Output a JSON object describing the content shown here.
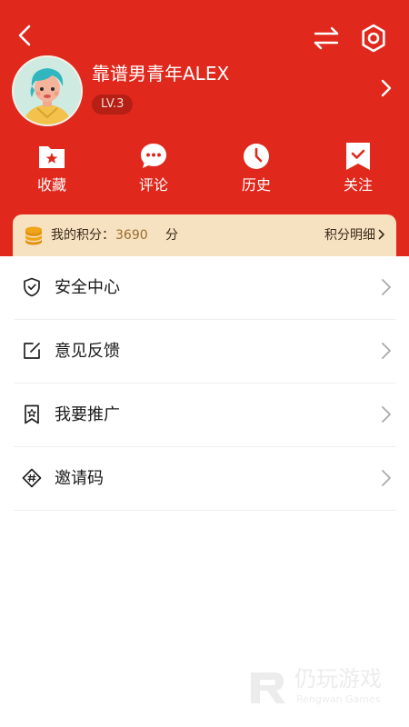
{
  "profile": {
    "username": "靠谱男青年ALEX",
    "level": "LV.3"
  },
  "shortcuts": [
    {
      "label": "收藏",
      "icon": "favorites-folder-icon"
    },
    {
      "label": "评论",
      "icon": "comment-bubble-icon"
    },
    {
      "label": "历史",
      "icon": "history-clock-icon"
    },
    {
      "label": "关注",
      "icon": "follow-bookmark-icon"
    }
  ],
  "points": {
    "label": "我的积分：",
    "value": "3690",
    "unit": "分",
    "detail_link": "积分明细"
  },
  "menu": [
    {
      "label": "安全中心",
      "icon": "shield-icon"
    },
    {
      "label": "意见反馈",
      "icon": "edit-icon"
    },
    {
      "label": "我要推广",
      "icon": "promo-bookmark-icon"
    },
    {
      "label": "邀请码",
      "icon": "hashtag-ticket-icon"
    }
  ],
  "watermark": {
    "title": "仍玩游戏",
    "subtitle": "Rengwan Games"
  },
  "colors": {
    "header": "#e0281c",
    "points_bar": "#f6e1c1",
    "points_value": "#9a6e2c"
  }
}
